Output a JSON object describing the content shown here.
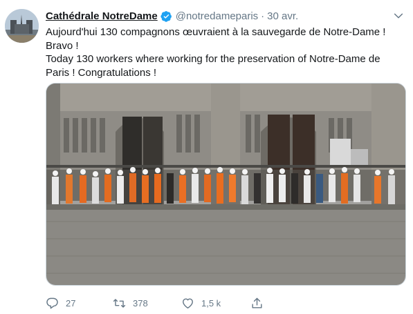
{
  "tweet": {
    "author_name": "Cathédrale NotreDame",
    "handle": "@notredameparis",
    "separator": "·",
    "date": "30 avr.",
    "text_lines": [
      "Aujourd'hui 130 compagnons œuvraient à la sauvegarde de Notre-Dame ! Bravo !",
      "Today 130 workers where working for the preservation of Notre-Dame de Paris ! Congratulations !"
    ],
    "media": {
      "kind": "photo"
    },
    "actions": {
      "replies": "27",
      "retweets": "378",
      "likes": "1,5 k"
    }
  },
  "icons": {
    "verified": "verified-badge-icon",
    "caret": "chevron-down-icon",
    "reply": "reply-icon",
    "retweet": "retweet-icon",
    "like": "heart-icon",
    "share": "share-icon"
  },
  "colors": {
    "text_primary": "#14171a",
    "text_secondary": "#657786",
    "verified_blue": "#1da1f2",
    "media_border": "#ccd6dd"
  }
}
